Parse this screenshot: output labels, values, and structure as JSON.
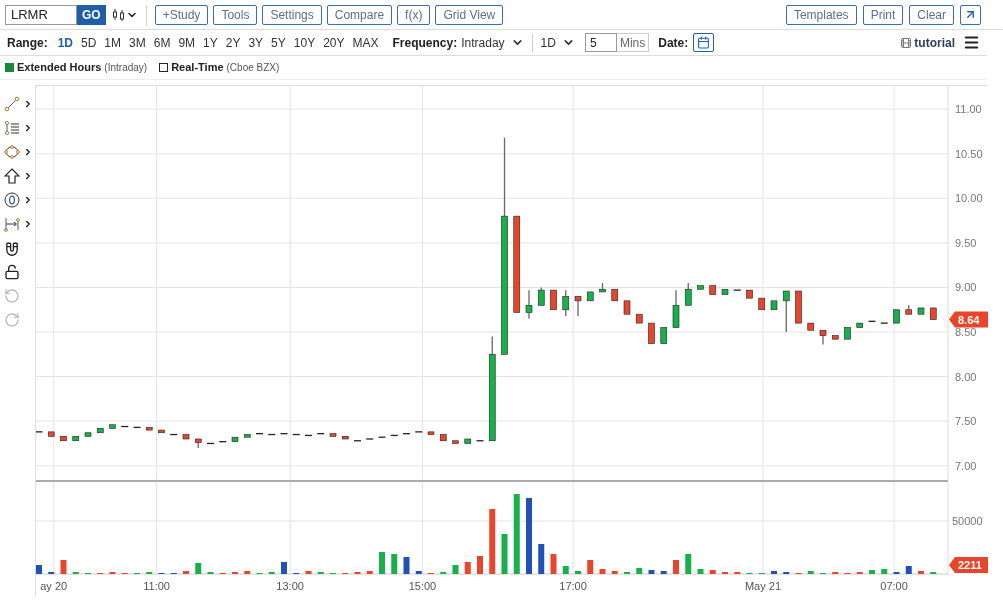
{
  "ticker": {
    "value": "LRMR",
    "go": "GO"
  },
  "toolbar_buttons": [
    "+Study",
    "Tools",
    "Settings",
    "Compare",
    "f(x)",
    "Grid View"
  ],
  "right_buttons": [
    "Templates",
    "Print",
    "Clear"
  ],
  "range": {
    "label": "Range:",
    "options": [
      {
        "label": "1D",
        "selected": true
      },
      {
        "label": "5D",
        "selected": false
      },
      {
        "label": "1M",
        "selected": false
      },
      {
        "label": "3M",
        "selected": false
      },
      {
        "label": "6M",
        "selected": false
      },
      {
        "label": "9M",
        "selected": false
      },
      {
        "label": "1Y",
        "selected": false
      },
      {
        "label": "2Y",
        "selected": false
      },
      {
        "label": "3Y",
        "selected": false
      },
      {
        "label": "5Y",
        "selected": false
      },
      {
        "label": "10Y",
        "selected": false
      },
      {
        "label": "20Y",
        "selected": false
      },
      {
        "label": "MAX",
        "selected": false
      }
    ]
  },
  "frequency": {
    "label": "Frequency:",
    "value": "Intraday"
  },
  "period": {
    "value": "1D"
  },
  "interval": {
    "value": "5",
    "unit": "Mins"
  },
  "date": {
    "label": "Date:"
  },
  "tutorial": "tutorial",
  "legend": [
    {
      "label": "Extended Hours",
      "note": "(Intraday)",
      "checked": true
    },
    {
      "label": "Real-Time",
      "note": "(Cboe BZX)",
      "checked": false
    }
  ],
  "drawing_tools": [
    {
      "kind": "line",
      "submenu": true,
      "disabled": false
    },
    {
      "kind": "fibonacci",
      "submenu": true,
      "disabled": false
    },
    {
      "kind": "shape",
      "submenu": true,
      "disabled": false
    },
    {
      "kind": "arrow",
      "submenu": true,
      "disabled": false
    },
    {
      "kind": "label",
      "submenu": true,
      "disabled": false
    },
    {
      "kind": "measure",
      "submenu": true,
      "disabled": false
    },
    {
      "kind": "magnet",
      "submenu": false,
      "disabled": false
    },
    {
      "kind": "lock",
      "submenu": false,
      "disabled": false
    },
    {
      "kind": "undo",
      "submenu": false,
      "disabled": true
    },
    {
      "kind": "redo",
      "submenu": false,
      "disabled": true
    }
  ],
  "price_chart": {
    "last_price": "8.64",
    "price_axis": [
      "11.00",
      "10.50",
      "10.00",
      "9.50",
      "9.00",
      "8.50",
      "8.00",
      "7.50",
      "7.00"
    ]
  },
  "volume_chart": {
    "ytick": "50000",
    "last_volume": "2211"
  },
  "time_axis": [
    "ay 20",
    "11:00",
    "13:00",
    "15:00",
    "17:00",
    "May 21",
    "07:00"
  ]
}
